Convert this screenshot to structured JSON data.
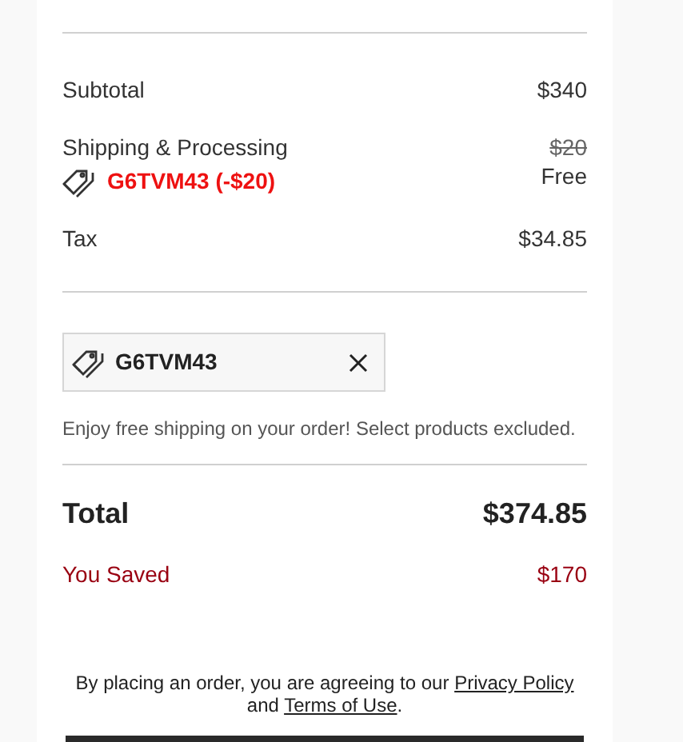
{
  "summary": {
    "rows": [
      {
        "kind": "plain",
        "label": "Subtotal",
        "value": "$340"
      },
      {
        "kind": "shipping",
        "label": "Shipping & Processing",
        "promo": "G6TVM43 (-$20)",
        "old_value": "$20",
        "value": "Free"
      },
      {
        "kind": "plain",
        "label": "Tax",
        "value": "$34.85"
      }
    ]
  },
  "promo_code": {
    "code": "G6TVM43",
    "note": "Enjoy free shipping on your order! Select products excluded."
  },
  "total": {
    "label": "Total",
    "value": "$374.85"
  },
  "saved": {
    "label": "You Saved",
    "value": "$170"
  },
  "legal": {
    "before": "By placing an order, you are agreeing to our",
    "privacy_link": "Privacy Policy",
    "middle": "and",
    "terms_link": "Terms of Use",
    "after": "."
  }
}
